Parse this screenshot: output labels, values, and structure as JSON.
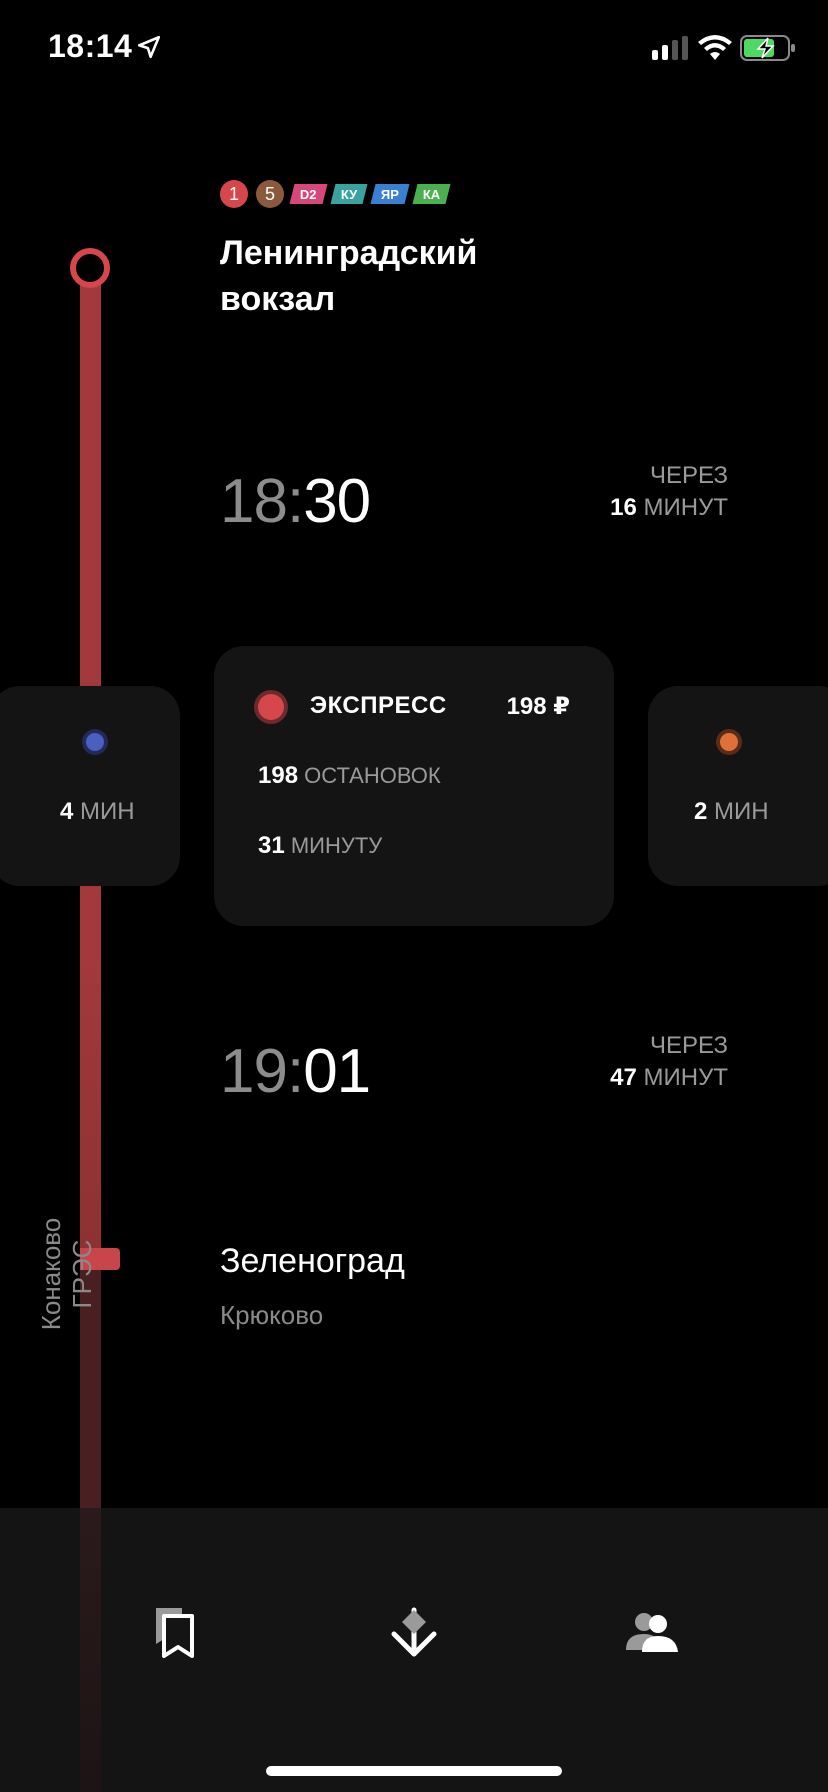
{
  "status_bar": {
    "time": "18:14",
    "icons": [
      "location-arrow-icon",
      "cellular-signal-icon",
      "wifi-icon",
      "battery-charging-icon"
    ]
  },
  "route": {
    "badges": [
      {
        "label": "1",
        "color": "#d6474b",
        "shape": "circle"
      },
      {
        "label": "5",
        "color": "#8b5a3c",
        "shape": "circle"
      },
      {
        "label": "D2",
        "color": "#d6477a",
        "shape": "tag"
      },
      {
        "label": "КУ",
        "color": "#3aa3a0",
        "shape": "tag"
      },
      {
        "label": "ЯР",
        "color": "#3a7fd0",
        "shape": "tag"
      },
      {
        "label": "КА",
        "color": "#4bb04f",
        "shape": "tag"
      }
    ],
    "origin_title": "Ленинградский вокзал",
    "line_name": "Конаково ГРЭС"
  },
  "departures": [
    {
      "hh": "18:",
      "mm": "30",
      "in_label": "ЧЕРЕЗ",
      "in_num": "16",
      "in_unit": "МИНУТ"
    },
    {
      "hh": "19:",
      "mm": "01",
      "in_label": "ЧЕРЕЗ",
      "in_num": "47",
      "in_unit": "МИНУТ"
    }
  ],
  "train_card": {
    "type": "ЭКСПРЕСС",
    "price": "198 ₽",
    "stops_num": "198",
    "stops_label": "ОСТАНОВОК",
    "duration_num": "31",
    "duration_label": "МИНУТУ",
    "color": "#d6474b"
  },
  "walk_left": {
    "num": "4",
    "unit": "МИН",
    "color": "#4a5fc0"
  },
  "walk_right": {
    "num": "2",
    "unit": "МИН",
    "color": "#e07038"
  },
  "destination": {
    "title": "Зеленоград",
    "subtitle": "Крюково"
  },
  "tabbar": {
    "tabs": [
      "bookmarks-icon",
      "route-direction-icon",
      "profile-icon"
    ]
  }
}
